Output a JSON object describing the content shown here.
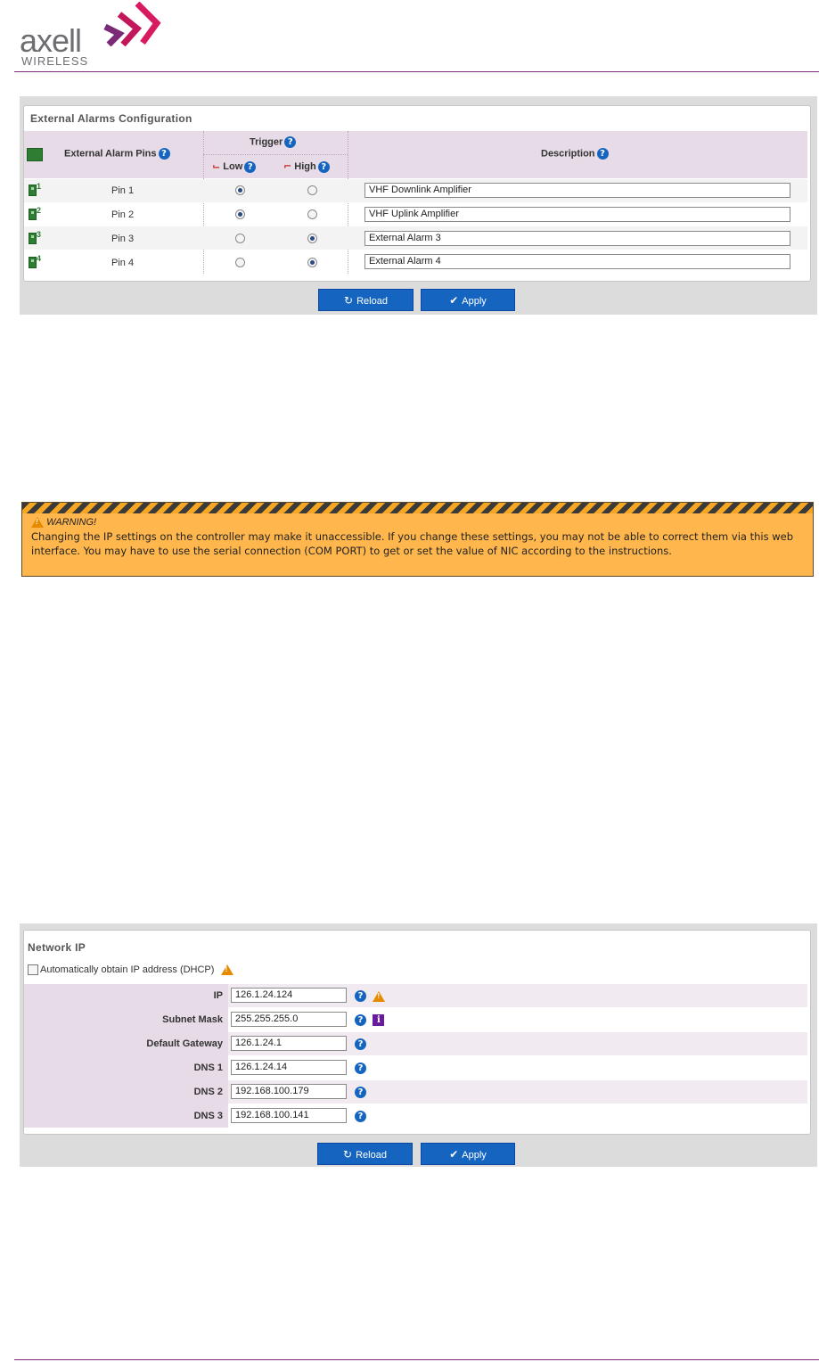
{
  "brand": {
    "name": "axell",
    "sub": "WIRELESS"
  },
  "alarms": {
    "title": "External Alarms Configuration",
    "headers": {
      "pins": "External Alarm Pins",
      "trigger": "Trigger",
      "low": "Low",
      "high": "High",
      "description": "Description"
    },
    "rows": [
      {
        "num": "1",
        "pin": "Pin 1",
        "trigger": "low",
        "description": "VHF Downlink Amplifier"
      },
      {
        "num": "2",
        "pin": "Pin 2",
        "trigger": "low",
        "description": "VHF Uplink Amplifier"
      },
      {
        "num": "3",
        "pin": "Pin 3",
        "trigger": "high",
        "description": "External Alarm 3"
      },
      {
        "num": "4",
        "pin": "Pin 4",
        "trigger": "high",
        "description": "External Alarm 4"
      }
    ],
    "reload_label": "Reload",
    "apply_label": "Apply"
  },
  "warning": {
    "title": "WARNING!",
    "text": "Changing the IP settings on the controller may make it unaccessible. If you change these settings, you may not be able to correct them via this web interface. You may have to use the serial connection (COM PORT) to get or set the value of NIC according to the instructions."
  },
  "network": {
    "title": "Network IP",
    "dhcp_label": "Automatically obtain IP address (DHCP)",
    "dhcp_checked": false,
    "fields": [
      {
        "label": "IP",
        "value": "126.1.24.124"
      },
      {
        "label": "Subnet Mask",
        "value": "255.255.255.0"
      },
      {
        "label": "Default Gateway",
        "value": "126.1.24.1"
      },
      {
        "label": "DNS 1",
        "value": "126.1.24.14"
      },
      {
        "label": "DNS 2",
        "value": "192.168.100.179"
      },
      {
        "label": "DNS 3",
        "value": "192.168.100.141"
      }
    ],
    "reload_label": "Reload",
    "apply_label": "Apply"
  },
  "colors": {
    "accent": "#7a2a77",
    "button": "#1565c0",
    "header_bg": "#e6dbe6",
    "warning_bg": "#ffb74d"
  },
  "icons": {
    "help": "question-circle",
    "warning": "warning-triangle",
    "info": "info-square",
    "reload": "refresh",
    "apply": "check"
  }
}
